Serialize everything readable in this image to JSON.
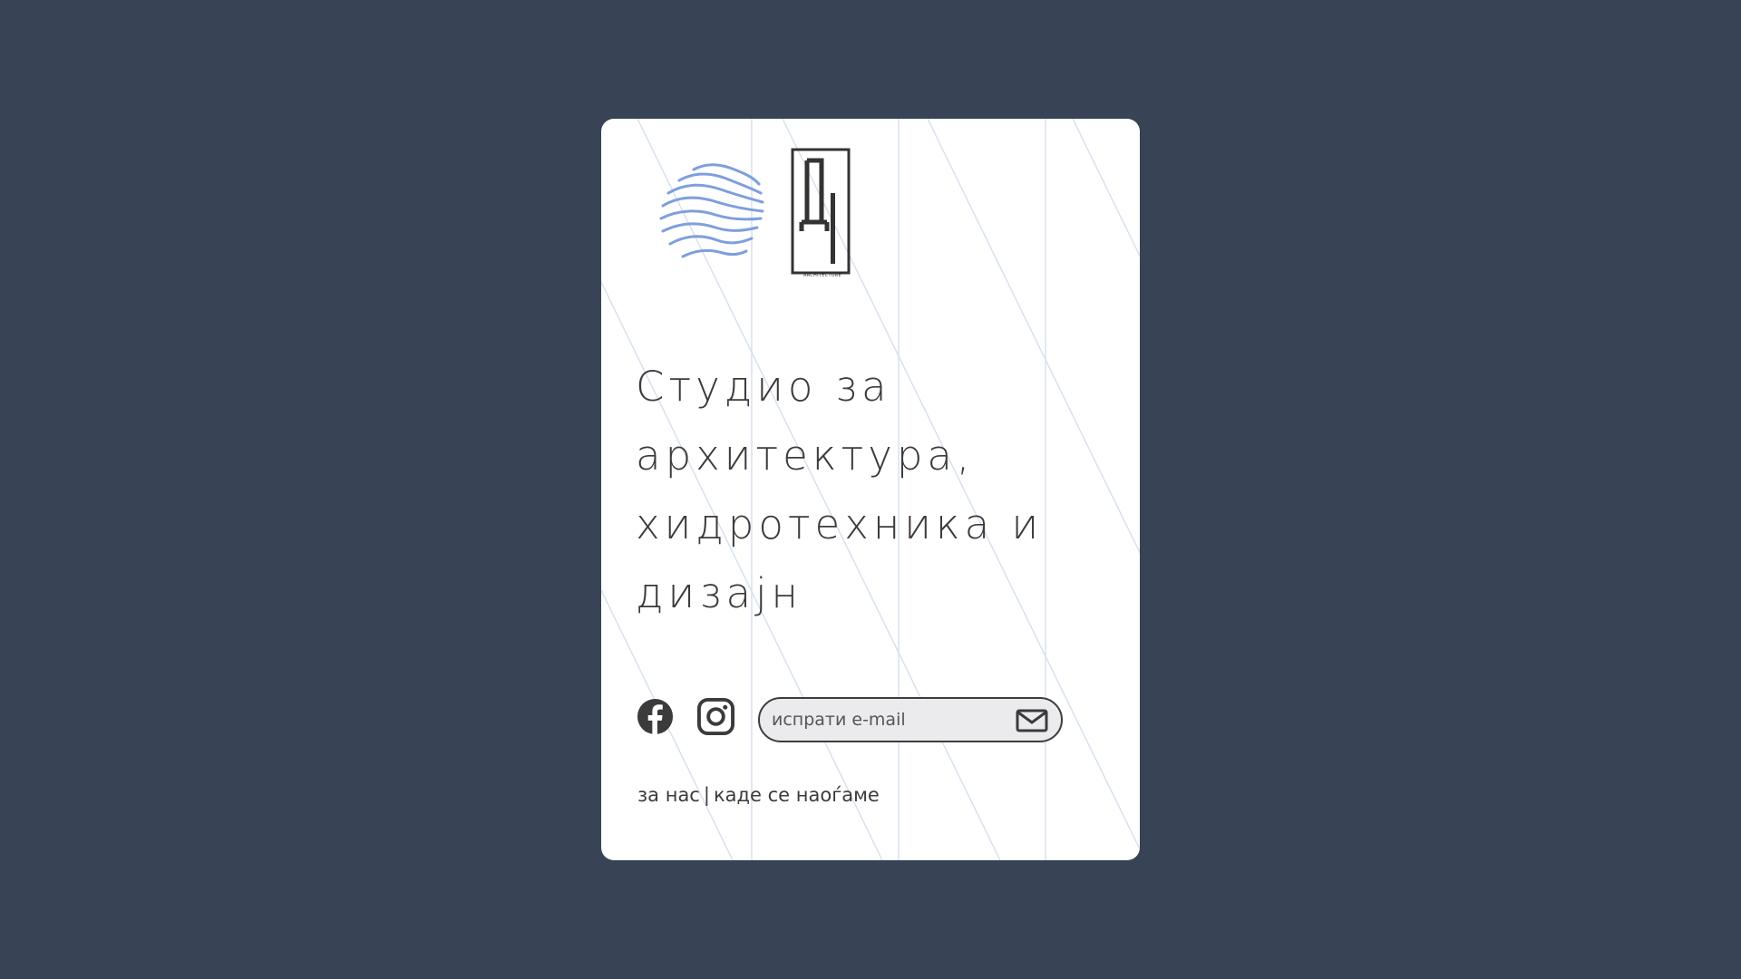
{
  "brand": {
    "logo_caption": "ARCHITECTURE",
    "accent_wave": "#7e9fdd",
    "ink": "#3b3b3b"
  },
  "hero": {
    "title_lines": [
      "Студио за",
      "архитектура,",
      "хидротехника и",
      "дизајн"
    ]
  },
  "social": {
    "facebook_icon": "facebook-icon",
    "instagram_icon": "instagram-icon"
  },
  "contact": {
    "email_placeholder": "испрати e-mail",
    "email_value": "",
    "send_icon": "mail-icon"
  },
  "footer": {
    "about_label": "за нас",
    "separator": "|",
    "location_label": "каде се наоѓаме"
  },
  "colors": {
    "page_background": "#384455",
    "card_background": "#ffffff",
    "grid_lines": "#d6e0ef",
    "input_background": "#ebebee"
  }
}
